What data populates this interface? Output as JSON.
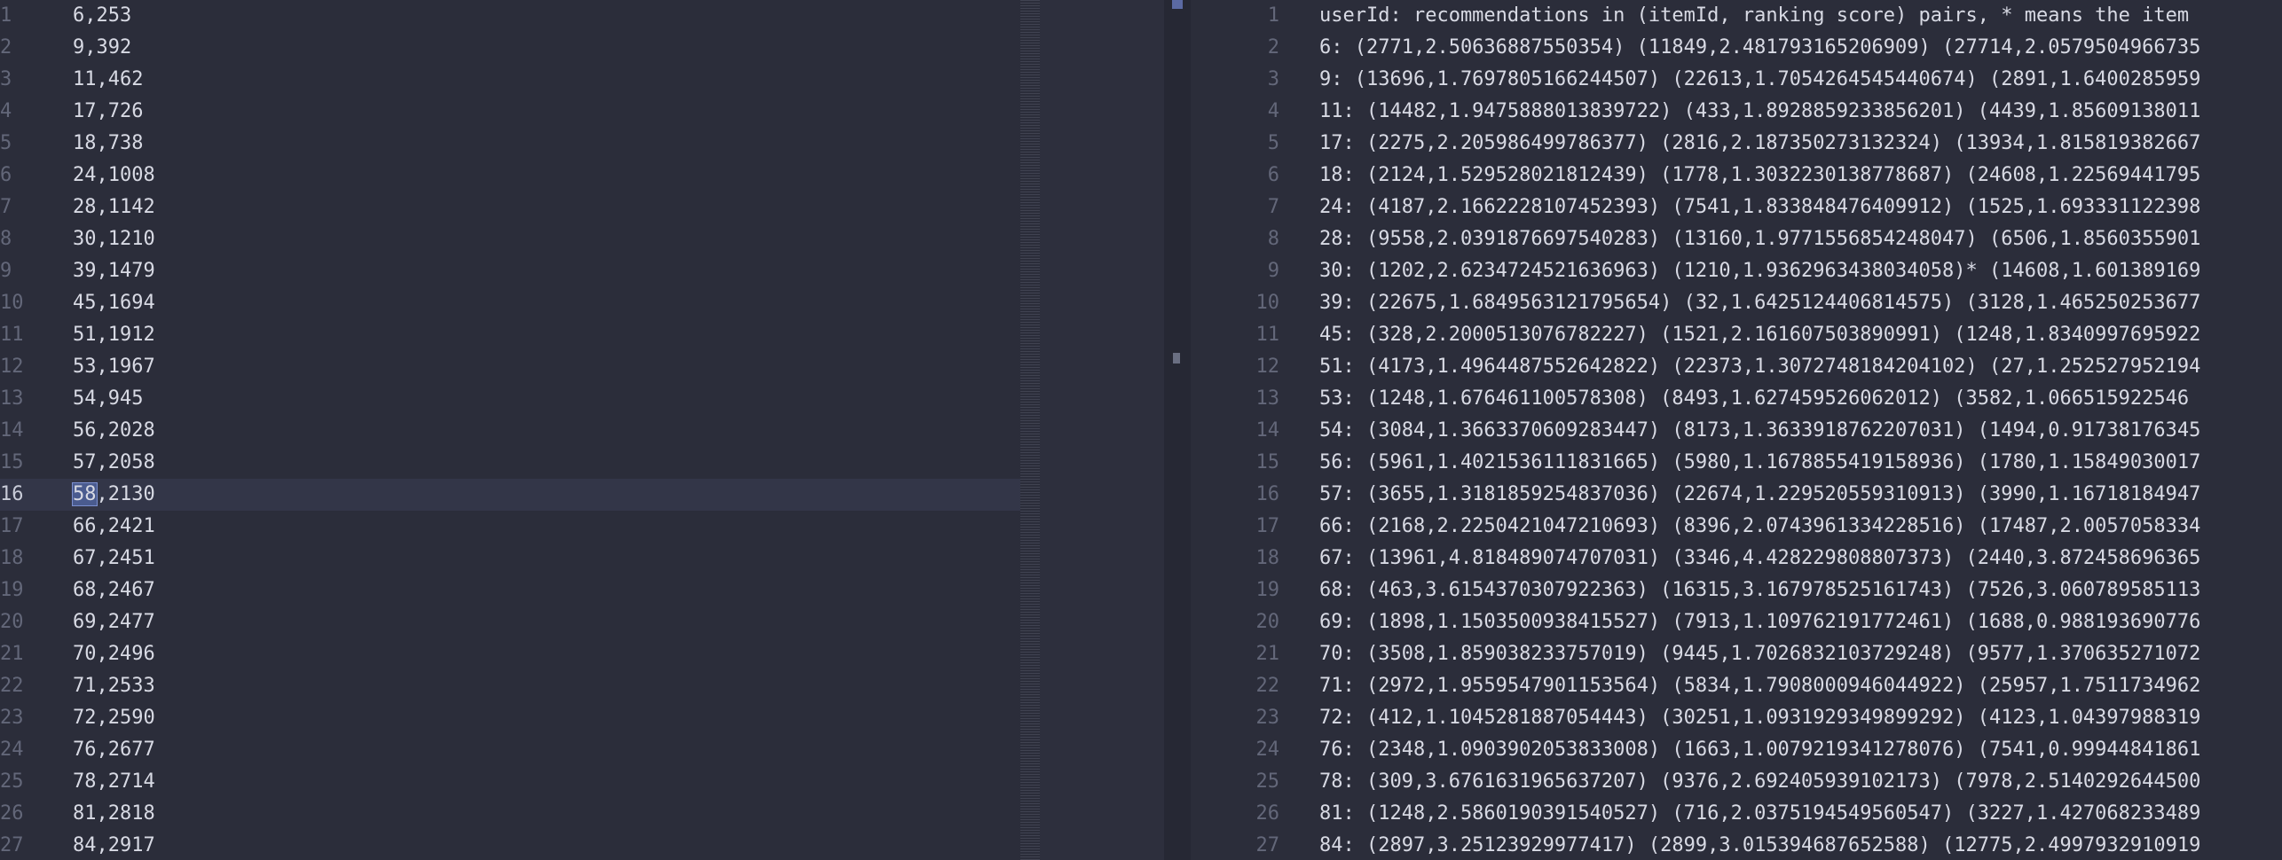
{
  "left_editor": {
    "current_line": 16,
    "selected_text": "58",
    "lines": [
      {
        "n": "1",
        "text": "6,253"
      },
      {
        "n": "2",
        "text": "9,392"
      },
      {
        "n": "3",
        "text": "11,462"
      },
      {
        "n": "4",
        "text": "17,726"
      },
      {
        "n": "5",
        "text": "18,738"
      },
      {
        "n": "6",
        "text": "24,1008"
      },
      {
        "n": "7",
        "text": "28,1142"
      },
      {
        "n": "8",
        "text": "30,1210"
      },
      {
        "n": "9",
        "text": "39,1479"
      },
      {
        "n": "10",
        "text": "45,1694"
      },
      {
        "n": "11",
        "text": "51,1912"
      },
      {
        "n": "12",
        "text": "53,1967"
      },
      {
        "n": "13",
        "text": "54,945"
      },
      {
        "n": "14",
        "text": "56,2028"
      },
      {
        "n": "15",
        "text": "57,2058"
      },
      {
        "n": "16",
        "text": "58,2130",
        "sel": "58",
        "rest": ",2130"
      },
      {
        "n": "17",
        "text": "66,2421"
      },
      {
        "n": "18",
        "text": "67,2451"
      },
      {
        "n": "19",
        "text": "68,2467"
      },
      {
        "n": "20",
        "text": "69,2477"
      },
      {
        "n": "21",
        "text": "70,2496"
      },
      {
        "n": "22",
        "text": "71,2533"
      },
      {
        "n": "23",
        "text": "72,2590"
      },
      {
        "n": "24",
        "text": "76,2677"
      },
      {
        "n": "25",
        "text": "78,2714"
      },
      {
        "n": "26",
        "text": "81,2818"
      },
      {
        "n": "27",
        "text": "84,2917"
      }
    ]
  },
  "right_editor": {
    "lines": [
      {
        "n": "1",
        "text": "userId: recommendations in (itemId, ranking score) pairs, * means the item"
      },
      {
        "n": "2",
        "text": "6: (2771,2.50636887550354) (11849,2.481793165206909) (27714,2.0579504966735"
      },
      {
        "n": "3",
        "text": "9: (13696,1.7697805166244507) (22613,1.7054264545440674) (2891,1.6400285959"
      },
      {
        "n": "4",
        "text": "11: (14482,1.9475888013839722) (433,1.8928859233856201) (4439,1.85609138011"
      },
      {
        "n": "5",
        "text": "17: (2275,2.205986499786377) (2816,2.187350273132324) (13934,1.815819382667"
      },
      {
        "n": "6",
        "text": "18: (2124,1.529528021812439) (1778,1.3032230138778687) (24608,1.22569441795"
      },
      {
        "n": "7",
        "text": "24: (4187,2.1662228107452393) (7541,1.833848476409912) (1525,1.693331122398"
      },
      {
        "n": "8",
        "text": "28: (9558,2.0391876697540283) (13160,1.9771556854248047) (6506,1.8560355901"
      },
      {
        "n": "9",
        "text": "30: (1202,2.6234724521636963) (1210,1.9362963438034058)* (14608,1.601389169"
      },
      {
        "n": "10",
        "text": "39: (22675,1.6849563121795654) (32,1.6425124406814575) (3128,1.465250253677"
      },
      {
        "n": "11",
        "text": "45: (328,2.2000513076782227) (1521,2.161607503890991) (1248,1.8340997695922"
      },
      {
        "n": "12",
        "text": "51: (4173,1.4964487552642822) (22373,1.3072748184204102) (27,1.252527952194"
      },
      {
        "n": "13",
        "text": "53: (1248,1.676461100578308) (8493,1.627459526062012) (3582,1.066515922546"
      },
      {
        "n": "14",
        "text": "54: (3084,1.3663370609283447) (8173,1.3633918762207031) (1494,0.91738176345"
      },
      {
        "n": "15",
        "text": "56: (5961,1.4021536111831665) (5980,1.1678855419158936) (1780,1.15849030017"
      },
      {
        "n": "16",
        "text": "57: (3655,1.3181859254837036) (22674,1.229520559310913) (3990,1.16718184947"
      },
      {
        "n": "17",
        "text": "66: (2168,2.2250421047210693) (8396,2.0743961334228516) (17487,2.0057058334"
      },
      {
        "n": "18",
        "text": "67: (13961,4.818489074707031) (3346,4.428229808807373) (2440,3.872458696365"
      },
      {
        "n": "19",
        "text": "68: (463,3.6154370307922363) (16315,3.167978525161743) (7526,3.060789585113"
      },
      {
        "n": "20",
        "text": "69: (1898,1.1503500938415527) (7913,1.109762191772461) (1688,0.988193690776"
      },
      {
        "n": "21",
        "text": "70: (3508,1.859038233757019) (9445,1.7026832103729248) (9577,1.370635271072"
      },
      {
        "n": "22",
        "text": "71: (2972,1.9559547901153564) (5834,1.7908000946044922) (25957,1.7511734962"
      },
      {
        "n": "23",
        "text": "72: (412,1.1045281887054443) (30251,1.0931929349899292) (4123,1.04397988319"
      },
      {
        "n": "24",
        "text": "76: (2348,1.0903902053833008) (1663,1.0079219341278076) (7541,0.99944841861"
      },
      {
        "n": "25",
        "text": "78: (309,3.6761631965637207) (9376,2.692405939102173) (7978,2.5140292644500"
      },
      {
        "n": "26",
        "text": "81: (1248,2.5860190391540527) (716,2.0375194549560547) (3227,1.427068233489"
      },
      {
        "n": "27",
        "text": "84: (2897,3.25123929977417) (2899,3.015394687652588) (12775,2.4997932910919"
      }
    ]
  },
  "colors": {
    "background": "#2b2d3a",
    "text": "#d8dae4",
    "line_number": "#636779",
    "current_line": "#333648",
    "selection": "#4a5b8f"
  }
}
